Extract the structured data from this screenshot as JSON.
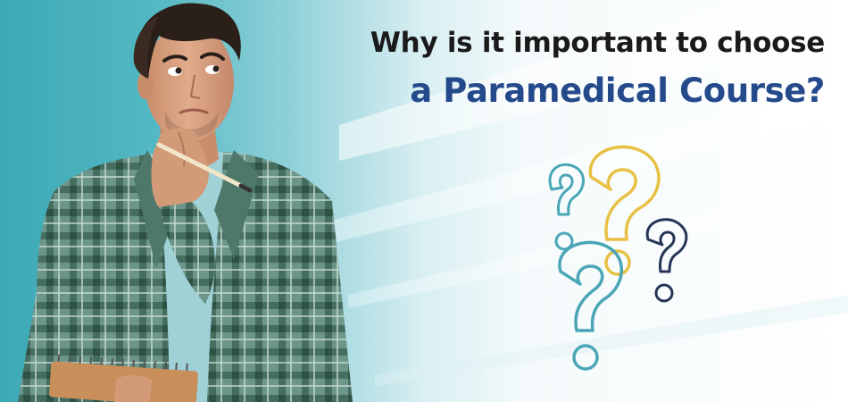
{
  "heading": {
    "line1": "Why is it important to choose",
    "line2": "a Paramedical Course?"
  },
  "colors": {
    "teal_background": "#3da9b5",
    "heading_dark": "#1a1a1a",
    "heading_blue": "#244a8c",
    "qmark_teal": "#4aa6b6",
    "qmark_yellow": "#e8c144",
    "qmark_navy": "#263556",
    "shirt_green": "#4c7566",
    "tshirt": "#9fd1d6",
    "skin": "#d8a07e",
    "hair": "#2b1f1a"
  },
  "icons": [
    "question-mark-icon"
  ]
}
